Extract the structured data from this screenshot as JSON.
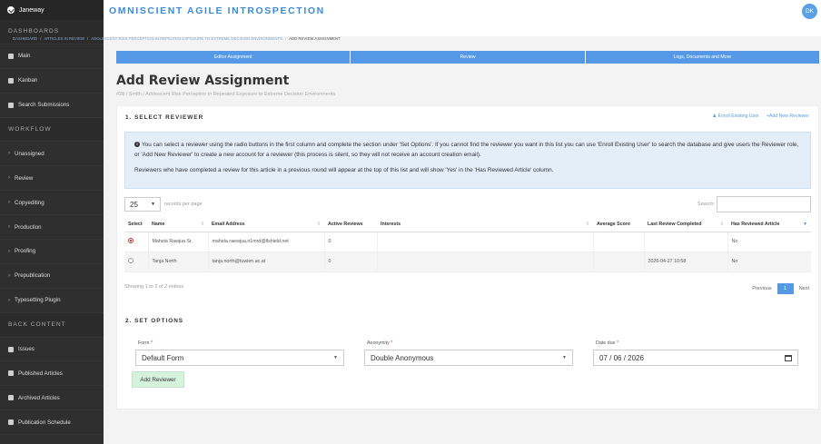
{
  "sidebar": {
    "brand": "Janeway",
    "items": [
      {
        "label": "DASHBOARDS",
        "type": "head"
      },
      {
        "label": "Main",
        "type": "link",
        "icon": "dashboard-icon"
      },
      {
        "label": "Kanban",
        "type": "link",
        "icon": "kanban-icon"
      },
      {
        "label": "Search Submissions",
        "type": "link",
        "icon": "list-icon"
      },
      {
        "label": "WORKFLOW",
        "type": "head"
      },
      {
        "label": "Unassigned",
        "type": "chev"
      },
      {
        "label": "Review",
        "type": "chev"
      },
      {
        "label": "Copyediting",
        "type": "chev"
      },
      {
        "label": "Production",
        "type": "chev"
      },
      {
        "label": "Proofing",
        "type": "chev"
      },
      {
        "label": "Prepublication",
        "type": "chev"
      },
      {
        "label": "Typesetting Plugin",
        "type": "chev"
      },
      {
        "label": "BACK CONTENT",
        "type": "head"
      },
      {
        "label": "Issues",
        "type": "link",
        "icon": "folder-icon"
      },
      {
        "label": "Published Articles",
        "type": "link",
        "icon": "file-icon"
      },
      {
        "label": "Archived Articles",
        "type": "link",
        "icon": "archive-icon"
      },
      {
        "label": "Publication Schedule",
        "type": "link",
        "icon": "calendar-icon"
      }
    ]
  },
  "header": {
    "title": "OMNISCIENT AGILE INTROSPECTION",
    "avatar": "DK"
  },
  "breadcrumb": [
    "DASHBOARD",
    "ARTICLES IN REVIEW",
    "ADOLESCENT RISK PERCEPTION IN REPEATED EXPOSURE TO EXTREME DECISION ENVIRONMENTS",
    "ADD REVIEW ASSIGNMENT"
  ],
  "tabs": [
    "Editor Assignment",
    "Review",
    "Logs, Documents and More"
  ],
  "page": {
    "title": "Add Review Assignment",
    "subtitle": "#28 / Smith / Adolescent Risk Perception in Repeated Exposure to Extreme Decision Environments"
  },
  "select_reviewer": {
    "title": "1. SELECT REVIEWER",
    "enroll_link": "Enroll Existing User",
    "add_link": "Add New Reviewer",
    "notice_1": "You can select a reviewer using the radio buttons in the first column and complete the section under 'Set Options'. If you cannot find the reviewer you want in this list you can use 'Enroll Existing User' to search the database and give users the Reviewer role, or 'Add New Reviewer' to create a new account for a reviewer (this process is silent, so they will not receive an account creation email).",
    "notice_2": "Reviewers who have completed a review for this article in a previous round will appear at the top of this list and will show 'Yes' in the 'Has Reviewed Article' column.",
    "page_length": "25",
    "records_label": "records per page",
    "search_label": "Search:",
    "search_value": "",
    "columns": [
      "Select",
      "Name",
      "Email Address",
      "Active Reviews",
      "Interests",
      "Average Score",
      "Last Review Completed",
      "Has Reviewed Article"
    ],
    "rows": [
      {
        "selected": true,
        "name": "Mahsta Rawjua Sr.",
        "email": "mahsta.raewjua.n1mrd@llshield.net",
        "active": "0",
        "interests": "",
        "score": "",
        "last": "",
        "reviewed": "No"
      },
      {
        "selected": false,
        "name": "Tanja North",
        "email": "tanja.north@tuwien.ac.at",
        "active": "0",
        "interests": "",
        "score": "",
        "last": "2026-04-27 10:58",
        "reviewed": "No"
      }
    ],
    "showing": "Showing 1 to 2 of 2 entries",
    "prev": "Previous",
    "page": "1",
    "next": "Next"
  },
  "set_options": {
    "title": "2. SET OPTIONS",
    "form_label": "Form",
    "form_value": "Default Form",
    "anon_label": "Anonymity",
    "anon_value": "Double Anonymous",
    "date_label": "Date due",
    "date_value": "07 / 06 / 2026",
    "required_mark": "*",
    "submit": "Add Reviewer"
  }
}
